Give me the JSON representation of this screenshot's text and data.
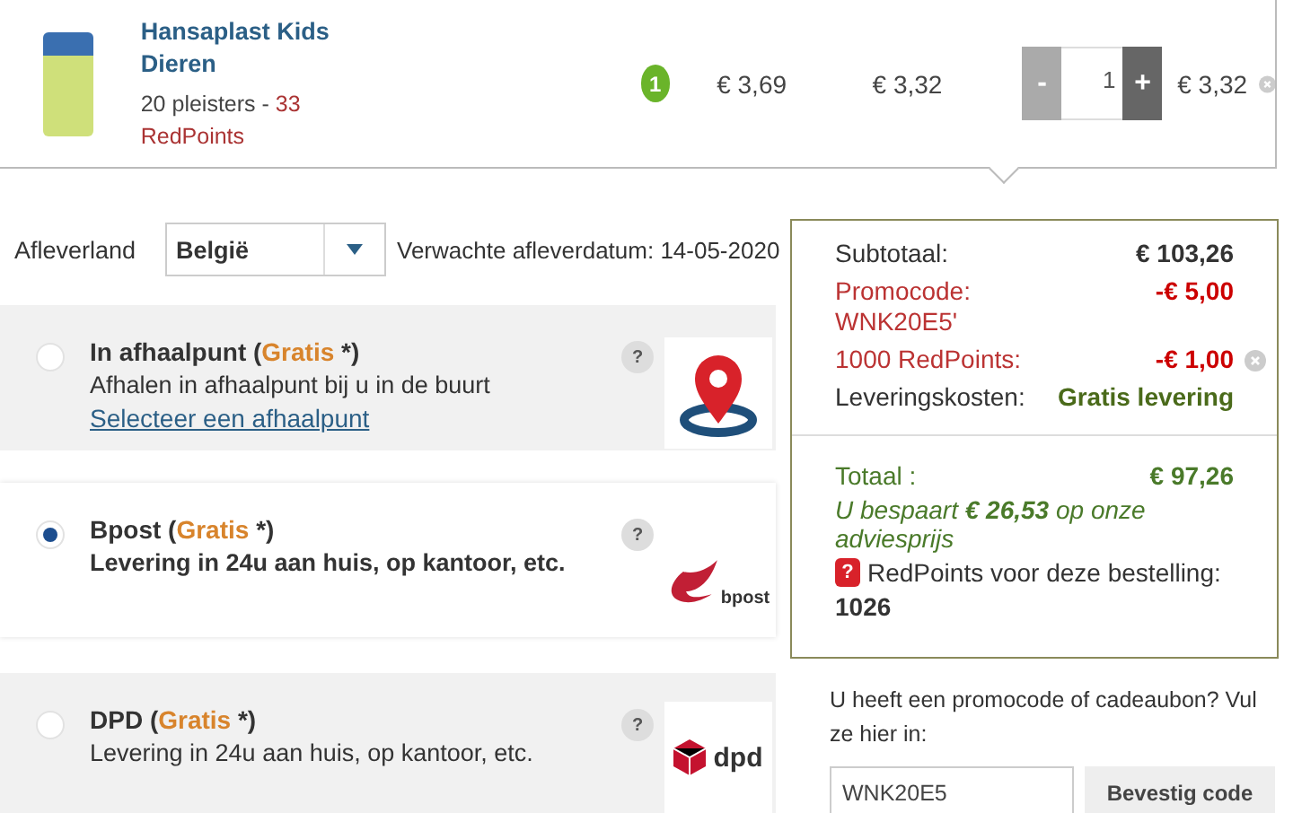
{
  "product": {
    "name": "Hansaplast Kids Dieren",
    "variant": "20 pleisters - ",
    "points": "33",
    "points_label": "RedPoints",
    "badge": "1",
    "price_list": "€ 3,69",
    "price_offer": "€ 3,32",
    "quantity": "1",
    "minus": "-",
    "plus": "+",
    "total": "€ 3,32"
  },
  "delivery": {
    "country_label": "Afleverland",
    "country_value": "België",
    "expected_date": "Verwachte afleverdatum: 14-05-2020"
  },
  "options": [
    {
      "title_before": "In afhaalpunt (",
      "tag": "Gratis",
      "title_after": " *)",
      "description": "Afhalen in afhaalpunt bij u in de buurt",
      "link": "Selecteer een afhaalpunt",
      "help": "?",
      "selected": false,
      "kind": "pin"
    },
    {
      "title_before": "Bpost (",
      "tag": "Gratis",
      "title_after": " *)",
      "description": "Levering in 24u aan huis, op kantoor, etc.",
      "help": "?",
      "selected": true,
      "kind": "bpost",
      "logo_text": "bpost"
    },
    {
      "title_before": "DPD (",
      "tag": "Gratis",
      "title_after": " *)",
      "description": "Levering in 24u aan huis, op kantoor, etc.",
      "help": "?",
      "selected": false,
      "kind": "dpd",
      "logo_text": "dpd"
    }
  ],
  "summary": {
    "rows": [
      {
        "label": "Subtotaal:",
        "value": "€ 103,26",
        "kind": "normal",
        "removable": false
      },
      {
        "label": "Promocode: WNK20E5'",
        "value": "-€ 5,00",
        "kind": "discount",
        "removable": false
      },
      {
        "label": "1000 RedPoints:",
        "value": "-€ 1,00",
        "kind": "discount",
        "removable": true
      },
      {
        "label": "Leveringskosten:",
        "value": "Gratis levering",
        "kind": "delivery",
        "removable": false
      }
    ],
    "total_label": "Totaal :",
    "total_value": "€ 97,26",
    "savings": "U bespaart **€ 26,53** op onze adviesprijs",
    "points_icon": "?",
    "points_text": "RedPoints voor deze bestelling:",
    "points_value": "1026"
  },
  "promo": {
    "prompt": "U heeft een promocode of cadeaubon? Vul ze hier in:",
    "value": "WNK20E5",
    "button": "Bevestig code"
  }
}
